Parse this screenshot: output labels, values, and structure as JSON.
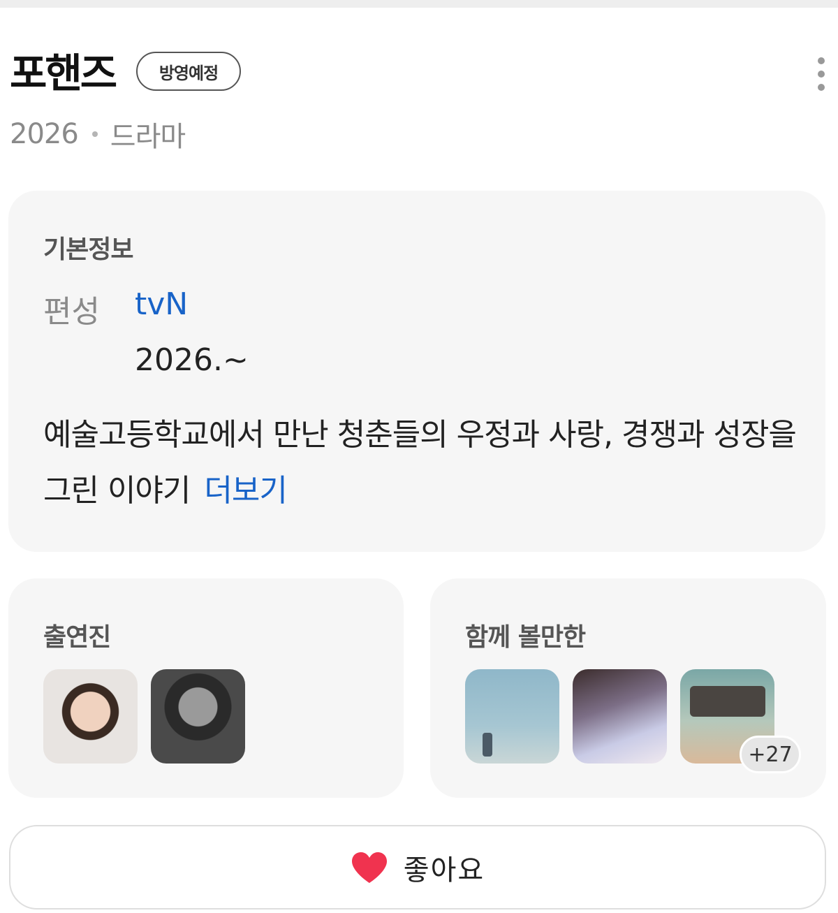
{
  "header": {
    "title": "포핸즈",
    "status_badge": "방영예정",
    "year": "2026",
    "genre": "드라마"
  },
  "info": {
    "section_title": "기본정보",
    "channel_label": "편성",
    "channel": "tvN",
    "air_date": "2026.~",
    "synopsis": "예술고등학교에서 만난 청춘들의 우정과 사랑, 경쟁과 성장을 그린 이야기",
    "more_label": "더보기"
  },
  "cast": {
    "section_title": "출연진"
  },
  "recommendations": {
    "section_title": "함께 볼만한",
    "more_count": "+27"
  },
  "like": {
    "label": "좋아요",
    "color": "#f0334f"
  },
  "colors": {
    "link": "#1863c8",
    "card_bg": "#f6f6f6"
  }
}
